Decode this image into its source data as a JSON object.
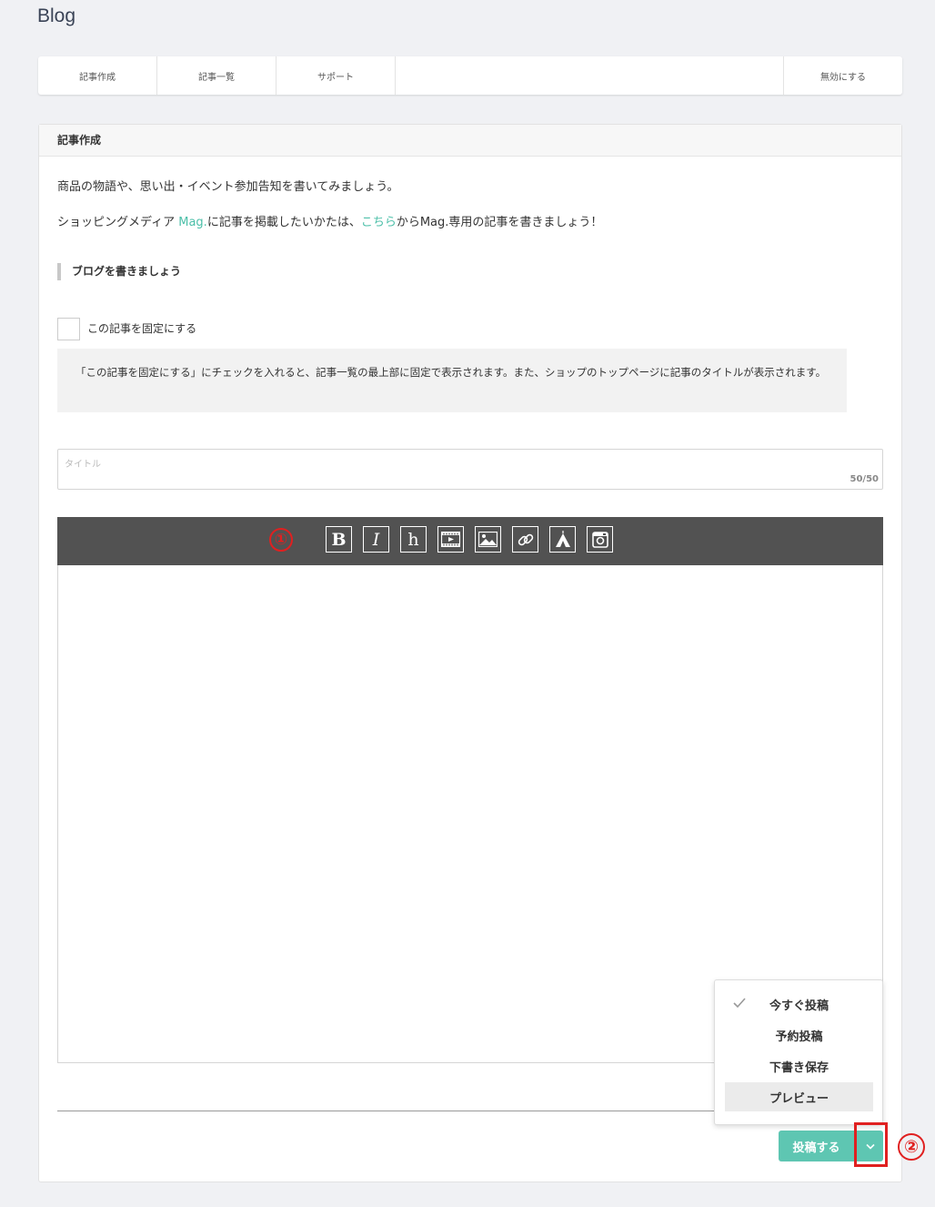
{
  "page_title": "Blog",
  "tabs": [
    "記事作成",
    "記事一覧",
    "サポート"
  ],
  "tab_right": "無効にする",
  "card": {
    "header": "記事作成",
    "intro": "商品の物語や、思い出・イベント参加告知を書いてみましょう。",
    "line2_prefix": "ショッピングメディア ",
    "line2_link1": "Mag.",
    "line2_mid": "に記事を掲載したいかたは、",
    "line2_link2": "こちら",
    "line2_suffix": "からMag.専用の記事を書きましょう！",
    "section_heading": "ブログを書きましょう",
    "pin_label": "この記事を固定にする",
    "pin_note": "「この記事を固定にする」にチェックを入れると、記事一覧の最上部に固定で表示されます。また、ショップのトップページに記事のタイトルが表示されます。",
    "title_placeholder": "タイトル",
    "title_counter": "50/50"
  },
  "toolbar": {
    "marker": "①",
    "icons": [
      "bold-icon",
      "italic-icon",
      "heading-icon",
      "video-icon",
      "image-icon",
      "link-icon",
      "tent-icon",
      "instagram-icon"
    ],
    "bold": "B",
    "italic": "I",
    "heading": "h"
  },
  "submit": {
    "label": "投稿する",
    "marker": "②"
  },
  "post_menu": {
    "items": [
      "今すぐ投稿",
      "予約投稿",
      "下書き保存",
      "プレビュー"
    ],
    "selected_index": 0,
    "highlighted_index": 3
  },
  "colors": {
    "accent": "#5ec6b2",
    "link": "#4bbfa8",
    "annotation": "#e02020",
    "toolbar_bg": "#525252"
  }
}
